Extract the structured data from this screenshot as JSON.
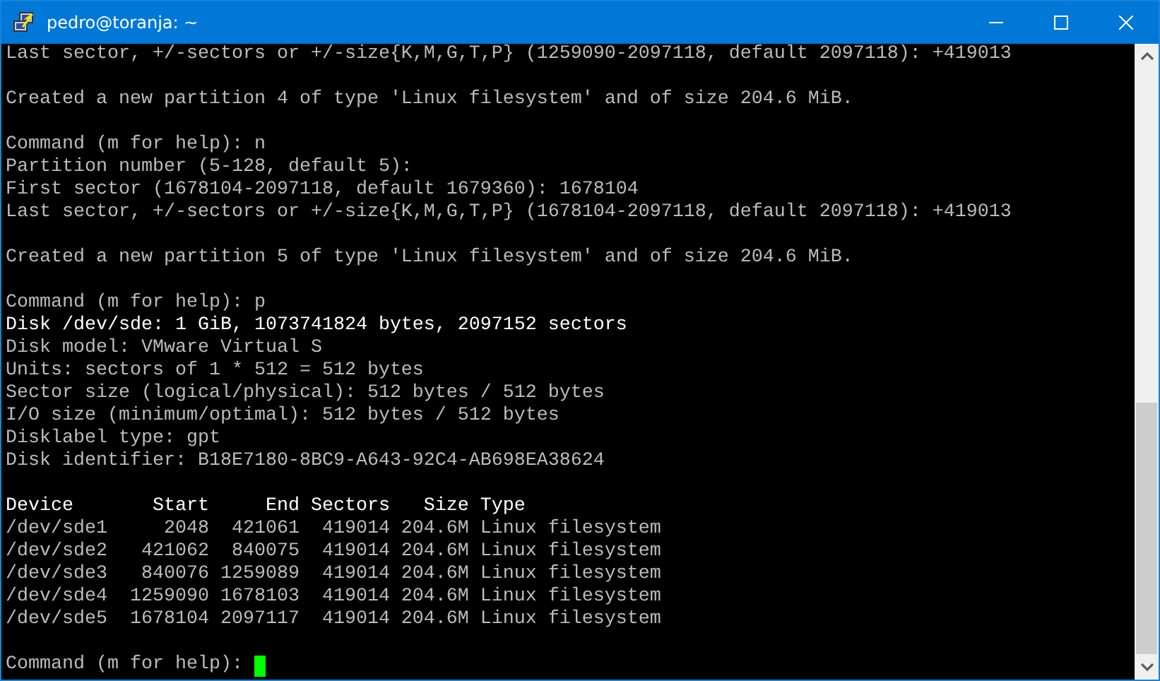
{
  "window": {
    "title": "pedro@toranja: ~"
  },
  "terminal": {
    "lines": [
      {
        "kind": "text",
        "text": "Last sector, +/-sectors or +/-size{K,M,G,T,P} (1259090-2097118, default 2097118): +419013"
      },
      {
        "kind": "blank"
      },
      {
        "kind": "text",
        "text": "Created a new partition 4 of type 'Linux filesystem' and of size 204.6 MiB."
      },
      {
        "kind": "blank"
      },
      {
        "kind": "text",
        "text": "Command (m for help): n"
      },
      {
        "kind": "text",
        "text": "Partition number (5-128, default 5):"
      },
      {
        "kind": "text",
        "text": "First sector (1678104-2097118, default 1679360): 1678104"
      },
      {
        "kind": "text",
        "text": "Last sector, +/-sectors or +/-size{K,M,G,T,P} (1678104-2097118, default 2097118): +419013"
      },
      {
        "kind": "blank"
      },
      {
        "kind": "text",
        "text": "Created a new partition 5 of type 'Linux filesystem' and of size 204.6 MiB."
      },
      {
        "kind": "blank"
      },
      {
        "kind": "text",
        "text": "Command (m for help): p"
      },
      {
        "kind": "bold",
        "text": "Disk /dev/sde: 1 GiB, 1073741824 bytes, 2097152 sectors"
      },
      {
        "kind": "text",
        "text": "Disk model: VMware Virtual S"
      },
      {
        "kind": "text",
        "text": "Units: sectors of 1 * 512 = 512 bytes"
      },
      {
        "kind": "text",
        "text": "Sector size (logical/physical): 512 bytes / 512 bytes"
      },
      {
        "kind": "text",
        "text": "I/O size (minimum/optimal): 512 bytes / 512 bytes"
      },
      {
        "kind": "text",
        "text": "Disklabel type: gpt"
      },
      {
        "kind": "text",
        "text": "Disk identifier: B18E7180-8BC9-A643-92C4-AB698EA38624"
      },
      {
        "kind": "blank"
      },
      {
        "kind": "bold",
        "text": "Device       Start     End Sectors   Size Type"
      },
      {
        "kind": "text",
        "text": "/dev/sde1     2048  421061  419014 204.6M Linux filesystem"
      },
      {
        "kind": "text",
        "text": "/dev/sde2   421062  840075  419014 204.6M Linux filesystem"
      },
      {
        "kind": "text",
        "text": "/dev/sde3   840076 1259089  419014 204.6M Linux filesystem"
      },
      {
        "kind": "text",
        "text": "/dev/sde4  1259090 1678103  419014 204.6M Linux filesystem"
      },
      {
        "kind": "text",
        "text": "/dev/sde5  1678104 2097117  419014 204.6M Linux filesystem"
      },
      {
        "kind": "blank"
      },
      {
        "kind": "prompt",
        "text": "Command (m for help): ",
        "cursor": true
      }
    ]
  }
}
